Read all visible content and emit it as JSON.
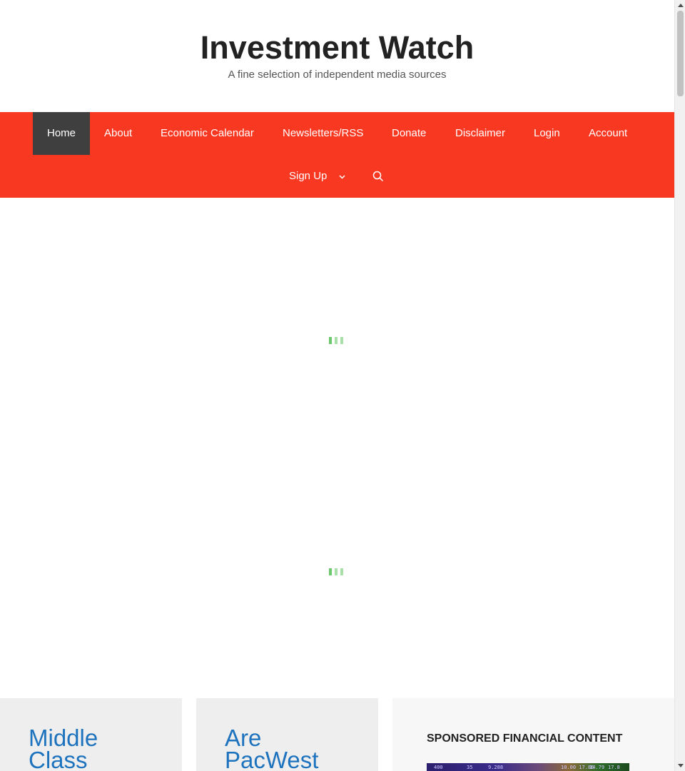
{
  "header": {
    "title": "Investment Watch",
    "tagline": "A fine selection of independent media sources"
  },
  "nav": {
    "items": [
      {
        "label": "Home",
        "active": true
      },
      {
        "label": "About"
      },
      {
        "label": "Economic Calendar"
      },
      {
        "label": "Newsletters/RSS"
      },
      {
        "label": "Donate"
      },
      {
        "label": "Disclaimer"
      },
      {
        "label": "Login"
      },
      {
        "label": "Account"
      },
      {
        "label": "Sign Up",
        "has_dropdown": true
      }
    ],
    "search_icon": "search-icon",
    "background_color": "#f93822",
    "active_color": "#3f3f3f"
  },
  "posts": [
    {
      "title": "Middle Class"
    },
    {
      "title": "Are PacWest"
    }
  ],
  "sidebar": {
    "heading": "SPONSORED FINANCIAL CONTENT",
    "image_ticker": [
      "400",
      "35",
      "9.288",
      "10.00  17.86",
      "14.79",
      "17.8"
    ]
  },
  "colors": {
    "link": "#1e73be",
    "card_background": "#eeeeee",
    "loader": "#7fd07f"
  }
}
